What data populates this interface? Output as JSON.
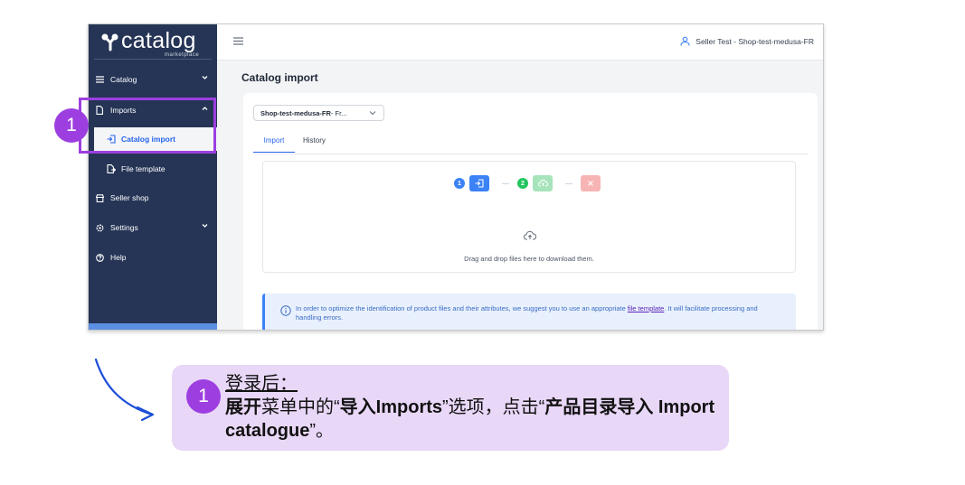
{
  "brand": {
    "logo_text": "catalog",
    "logo_sub": "marketplace"
  },
  "sidebar": {
    "items": [
      {
        "label": "Catalog",
        "icon": "list-icon",
        "expanded": false
      },
      {
        "label": "Imports",
        "icon": "file-icon",
        "expanded": true
      },
      {
        "label": "Catalog import",
        "icon": "import-icon",
        "active": true
      },
      {
        "label": "File template",
        "icon": "file-export-icon"
      },
      {
        "label": "Seller shop",
        "icon": "shop-icon"
      },
      {
        "label": "Settings",
        "icon": "gear-icon",
        "expanded": false
      },
      {
        "label": "Help",
        "icon": "help-icon"
      }
    ]
  },
  "header": {
    "user": "Seller Test - Shop-test-medusa-FR"
  },
  "page": {
    "title": "Catalog import",
    "shop_select_bold": "Shop-test-medusa-FR",
    "shop_select_rest": " - Fr...",
    "tabs": [
      "Import",
      "History"
    ],
    "steps": [
      {
        "number": "1",
        "color": "#3b82f6"
      },
      {
        "number": "2",
        "color": "#22c55e"
      }
    ],
    "drop_text": "Drag and drop files here to download them.",
    "info_before": "In order to optimize the identification of product files and their attributes, we suggest you to use an appropriate ",
    "info_link": "file template",
    "info_after": ". It will facilitate processing and handling errors."
  },
  "annotation": {
    "badge": "1",
    "callout_badge": "1",
    "head": "登录后：",
    "line_bold1": "展开",
    "line_text1": "菜单中的“",
    "line_bold2": "导入Imports",
    "line_text2": "”选项，点击“",
    "line_bold3": "产品目录导入 Import catalogue",
    "line_text3": "”。",
    "accent": "#9d3fe0"
  }
}
